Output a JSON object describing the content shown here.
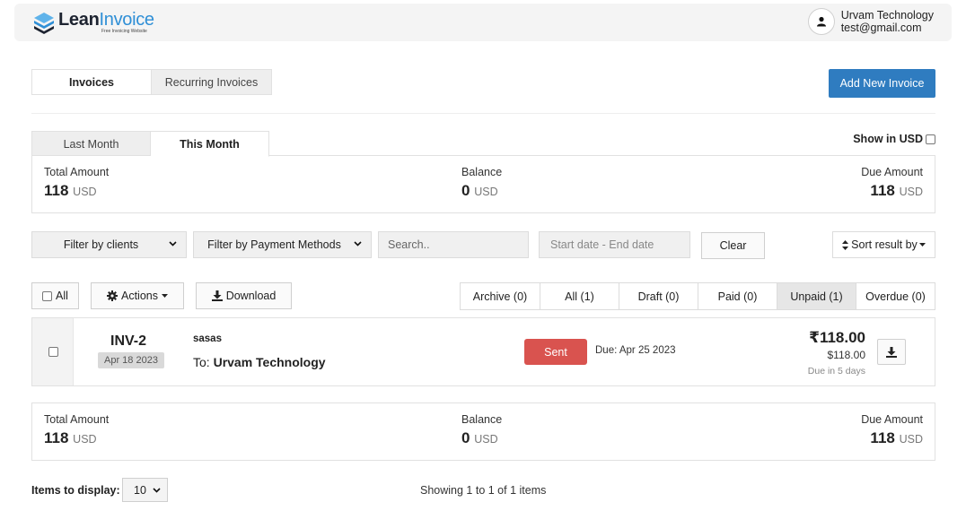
{
  "header": {
    "logo_bold": "Lean",
    "logo_light": "Invoice",
    "logo_tagline": "Free Invoicing Website",
    "user_name": "Urvam Technology",
    "user_email": "test@gmail.com",
    "logo_icon": "stacked-layers-logo-icon",
    "avatar_icon": "user-icon"
  },
  "tabs": {
    "invoices": "Invoices",
    "recurring": "Recurring Invoices"
  },
  "add_button": "Add New Invoice",
  "period_tabs": {
    "last_month": "Last Month",
    "this_month": "This Month"
  },
  "show_usd": "Show in USD",
  "summary_top": {
    "total_label": "Total Amount",
    "total_value": "118",
    "total_unit": "USD",
    "balance_label": "Balance",
    "balance_value": "0",
    "balance_unit": "USD",
    "due_label": "Due Amount",
    "due_value": "118",
    "due_unit": "USD"
  },
  "filters": {
    "clients": "Filter by clients",
    "payment": "Filter by Payment Methods",
    "search_placeholder": "Search..",
    "date_placeholder": "Start date - End date",
    "clear": "Clear",
    "sort": "Sort result by"
  },
  "toolbar": {
    "all": "All",
    "actions": "Actions",
    "download": "Download"
  },
  "status_tabs": [
    "Archive (0)",
    "All (1)",
    "Draft (0)",
    "Paid (0)",
    "Unpaid (1)",
    "Overdue (0)"
  ],
  "invoice": {
    "number": "INV-2",
    "date": "Apr 18 2023",
    "description": "sasas",
    "to_prefix": "To:",
    "client": "Urvam Technology",
    "status": "Sent",
    "due": "Due: Apr 25 2023",
    "amount": "₹118.00",
    "amount_usd": "$118.00",
    "due_in": "Due in 5 days"
  },
  "summary_bottom": {
    "total_label": "Total Amount",
    "total_value": "118",
    "total_unit": "USD",
    "balance_label": "Balance",
    "balance_value": "0",
    "balance_unit": "USD",
    "due_label": "Due Amount",
    "due_value": "118",
    "due_unit": "USD"
  },
  "footer": {
    "items_label": "Items to display:",
    "items_value": "10",
    "showing": "Showing 1 to 1 of 1 items"
  },
  "colors": {
    "accent": "#2f7cc0",
    "sent": "#d9534f",
    "logo_blue": "#2f8fd6"
  }
}
